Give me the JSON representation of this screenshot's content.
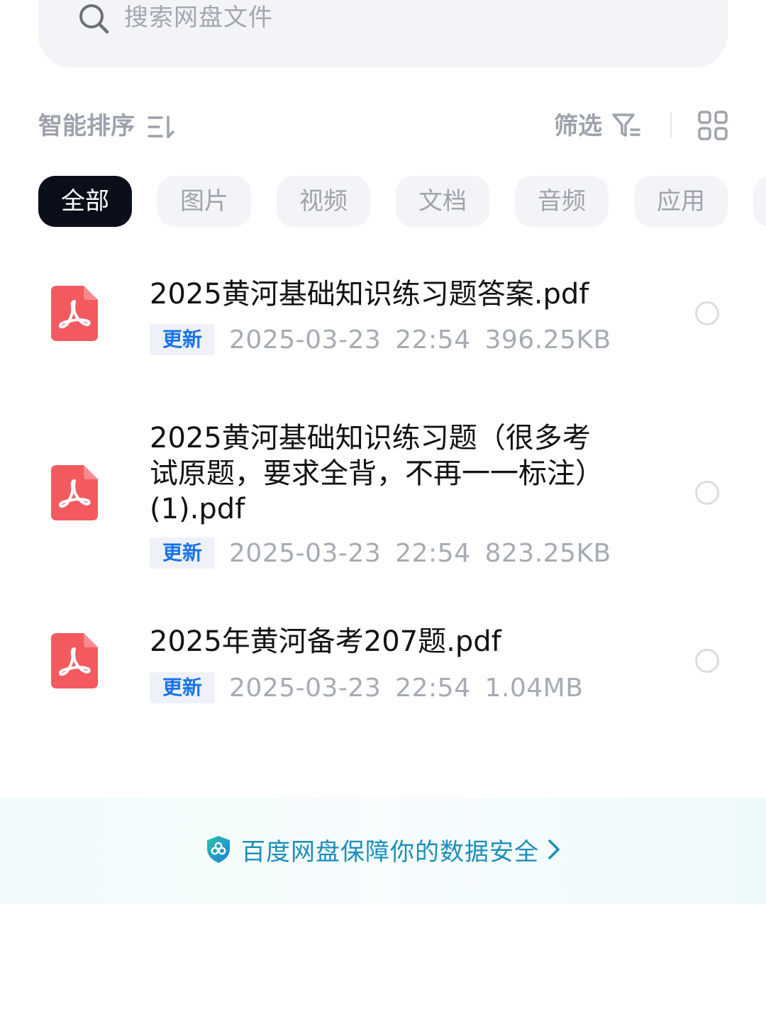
{
  "search": {
    "placeholder": "搜索网盘文件"
  },
  "toolbar": {
    "sort_label": "智能排序",
    "filter_label": "筛选",
    "icons": [
      "sort-icon",
      "filter-icon",
      "grid-view-icon"
    ]
  },
  "categories": [
    {
      "label": "全部",
      "active": true
    },
    {
      "label": "图片",
      "active": false
    },
    {
      "label": "视频",
      "active": false
    },
    {
      "label": "文档",
      "active": false
    },
    {
      "label": "音频",
      "active": false
    },
    {
      "label": "应用",
      "active": false
    }
  ],
  "files": [
    {
      "name_lines": [
        "2025黄河基础知识练习题答案.pdf"
      ],
      "badge": "更新",
      "date": "2025-03-23",
      "time": "22:54",
      "size": "396.25KB",
      "icon": "pdf-icon"
    },
    {
      "name_lines": [
        "2025黄河基础知识练习题（很多考",
        "试原题，要求全背，不再一一标注）",
        "(1).pdf"
      ],
      "badge": "更新",
      "date": "2025-03-23",
      "time": "22:54",
      "size": "823.25KB",
      "icon": "pdf-icon"
    },
    {
      "name_lines": [
        "2025年黄河备考207题.pdf"
      ],
      "badge": "更新",
      "date": "2025-03-23",
      "time": "22:54",
      "size": "1.04MB",
      "icon": "pdf-icon"
    }
  ],
  "banner": {
    "text": "百度网盘保障你的数据安全"
  },
  "colors": {
    "accent_blue": "#1a73e8",
    "active_chip": "#0b0f1a",
    "pdf_red": "#f25a5f",
    "banner_text": "#1a8fb9"
  }
}
